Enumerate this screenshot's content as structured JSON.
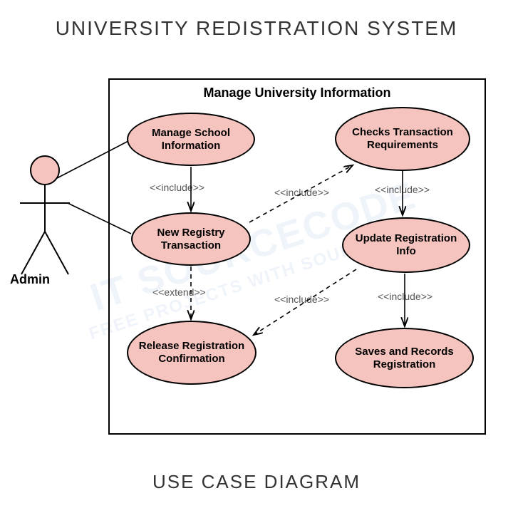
{
  "title": "UNIVERSITY REDISTRATION SYSTEM",
  "subtitle": "USE CASE DIAGRAM",
  "actor": {
    "name": "Admin"
  },
  "system": {
    "label": "Manage University Information"
  },
  "usecases": {
    "uc1": "Manage School Information",
    "uc2": "New Registry Transaction",
    "uc3": "Release Registration Confirmation",
    "uc4": "Checks Transaction Requirements",
    "uc5": "Update Registration Info",
    "uc6": "Saves and Records Registration"
  },
  "stereotypes": {
    "s1": "<<include>>",
    "s2": "<<include>>",
    "s3": "<<extend>>",
    "s4": "<<include>>",
    "s5": "<<include>>",
    "s6": "<<include>>"
  },
  "watermark": {
    "main": "IT SOURCECODE",
    "sub": "FREE PROJECTS WITH SOURCE CODE"
  }
}
